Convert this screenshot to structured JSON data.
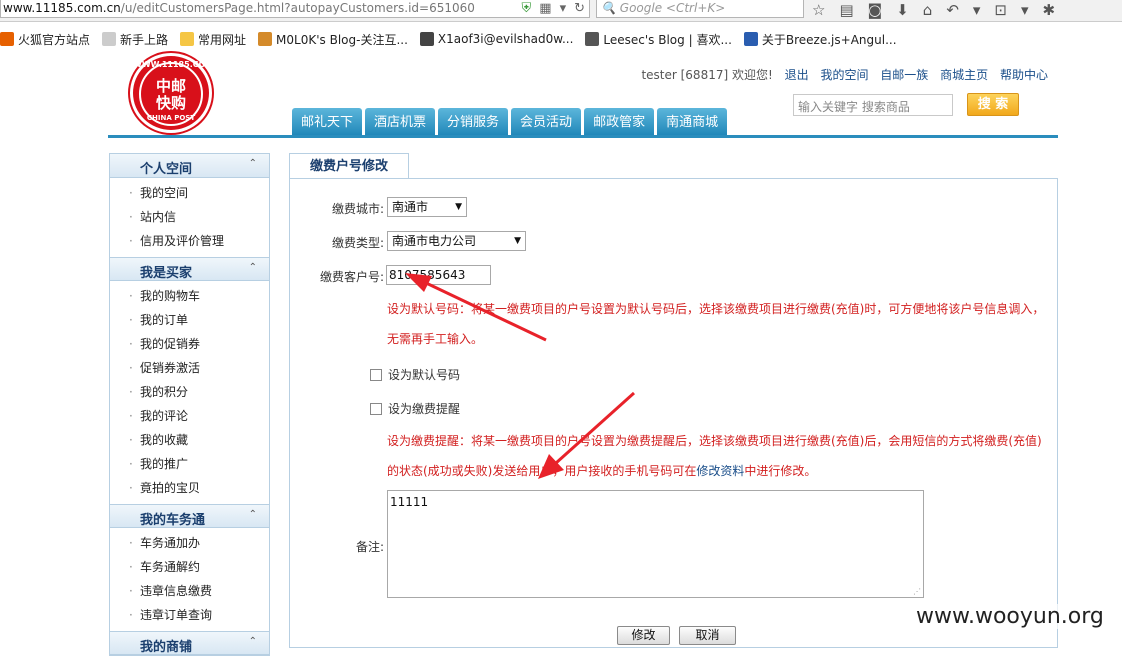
{
  "browser": {
    "url_host": "www.11185.com.cn",
    "url_path": "/u/editCustomersPage.html?autopayCustomers.id=651060",
    "search_placeholder": "Google <Ctrl+K>",
    "bookmarks": [
      {
        "label": "火狐官方站点",
        "icon": "firefox-icon",
        "color": "#e66000"
      },
      {
        "label": "新手上路",
        "icon": "page-icon",
        "color": "#cccccc"
      },
      {
        "label": "常用网址",
        "icon": "folder-icon",
        "color": "#f5c645"
      },
      {
        "label": "M0L0K's Blog-关注互...",
        "icon": "blog-icon",
        "color": "#d48a2a"
      },
      {
        "label": "X1aof3i@evilshad0w...",
        "icon": "page-icon",
        "color": "#444444"
      },
      {
        "label": "Leesec's Blog | 喜欢...",
        "icon": "blog-icon",
        "color": "#555555"
      },
      {
        "label": "关于Breeze.js+Angul...",
        "icon": "globe-icon",
        "color": "#2a5db0"
      }
    ]
  },
  "site": {
    "logo_url": "WWW.11185.COM.CN",
    "logo_line1": "中邮",
    "logo_line2": "快购",
    "logo_sub": "CHINA POST",
    "user_greeting": "tester [68817] 欢迎您!",
    "links": [
      "退出",
      "我的空间",
      "自邮一族",
      "商城主页",
      "帮助中心"
    ],
    "search_placeholder": "输入关键字 搜索商品",
    "search_button": "搜 索",
    "nav": [
      "邮礼天下",
      "酒店机票",
      "分销服务",
      "会员活动",
      "邮政管家",
      "南通商城"
    ]
  },
  "sidebar": {
    "sections": [
      {
        "title": "个人空间",
        "items": [
          "我的空间",
          "站内信",
          "信用及评价管理"
        ]
      },
      {
        "title": "我是买家",
        "items": [
          "我的购物车",
          "我的订单",
          "我的促销券",
          "促销券激活",
          "我的积分",
          "我的评论",
          "我的收藏",
          "我的推广",
          "竟拍的宝贝"
        ]
      },
      {
        "title": "我的车务通",
        "items": [
          "车务通加办",
          "车务通解约",
          "违章信息缴费",
          "违章订单查询"
        ]
      },
      {
        "title": "我的商铺",
        "items": []
      }
    ]
  },
  "form": {
    "tab_title": "缴费户号修改",
    "city_label": "缴费城市:",
    "city_value": "南通市",
    "type_label": "缴费类型:",
    "type_value": "南通市电力公司",
    "account_label": "缴费客户号:",
    "account_value": "8107585643",
    "default_hint_line1": "设为默认号码：将某一缴费项目的户号设置为默认号码后，选择该缴费项目进行缴费(充值)时，可方便地将该户号信息调入，",
    "default_hint_line2": "无需再手工输入。",
    "default_checkbox": "设为默认号码",
    "reminder_checkbox": "设为缴费提醒",
    "reminder_hint_line1": "设为缴费提醒：将某一缴费项目的户号设置为缴费提醒后，选择该缴费项目进行缴费(充值)后，会用短信的方式将缴费(充值)",
    "reminder_hint_line2a": "的状态(成功或失败)发送给用户，用户接收的手机号码可在",
    "reminder_hint_link": "修改资料",
    "reminder_hint_line2b": "中进行修改。",
    "remark_label": "备注:",
    "remark_value": "11111",
    "modify_button": "修改",
    "cancel_button": "取消"
  },
  "watermark": "www.wooyun.org"
}
